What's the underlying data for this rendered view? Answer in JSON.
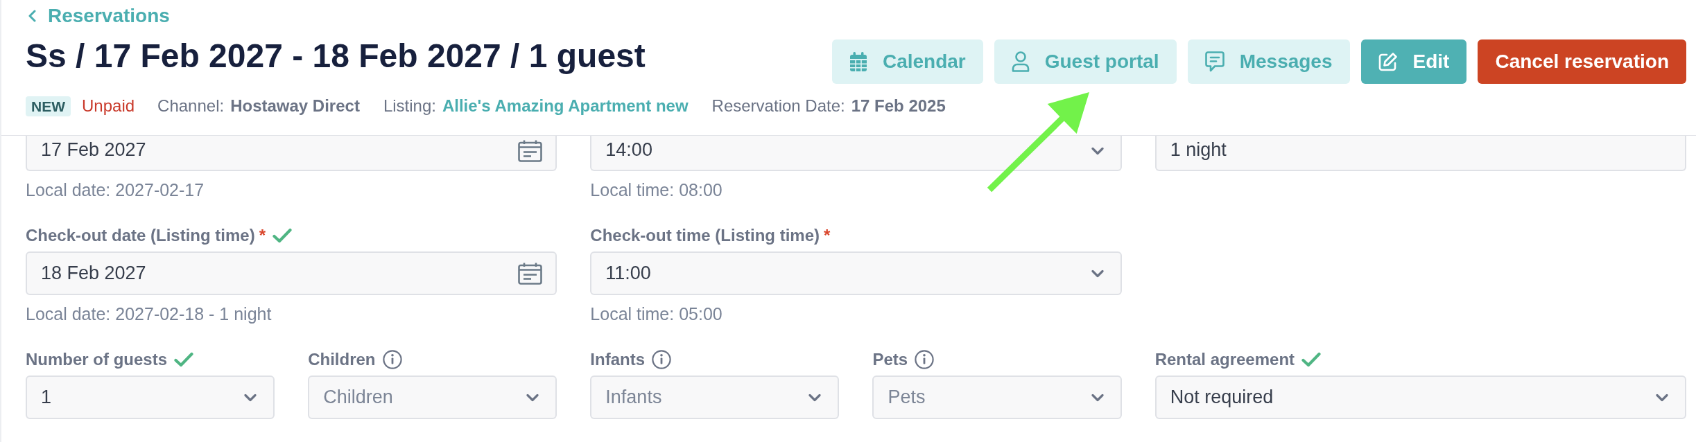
{
  "back_link": {
    "label": "Reservations"
  },
  "title": "Ss / 17 Feb 2027 - 18 Feb 2027 / 1 guest",
  "status": {
    "badge": "NEW",
    "payment": "Unpaid"
  },
  "details": [
    {
      "label": "Channel:",
      "value": "Hostaway Direct",
      "kind": "text"
    },
    {
      "label": "Listing:",
      "value": "Allie's Amazing Apartment new",
      "kind": "link"
    },
    {
      "label": "Reservation Date:",
      "value": "17 Feb 2025",
      "kind": "text"
    }
  ],
  "actions": [
    {
      "label": "Calendar",
      "kind": "soft"
    },
    {
      "label": "Guest portal",
      "kind": "soft"
    },
    {
      "label": "Messages",
      "kind": "soft"
    },
    {
      "label": "Edit",
      "kind": "primary"
    },
    {
      "label": "Cancel reservation",
      "kind": "danger"
    }
  ],
  "form": {
    "rows": [
      {
        "fields": [
          {
            "kind": "date",
            "value": "17 Feb 2027",
            "helper": "Local date: 2027-02-17"
          },
          {
            "kind": "select",
            "value": "14:00",
            "helper": "Local time: 08:00"
          },
          {
            "kind": "text",
            "value": "1 night"
          }
        ]
      },
      {
        "fields": [
          {
            "kind": "date",
            "label": "Check-out date (Listing time)",
            "required_mark": "*",
            "verified": true,
            "info": false,
            "value": "18 Feb 2027",
            "helper": "Local date: 2027-02-18 - 1 night"
          },
          {
            "kind": "select",
            "label": "Check-out time (Listing time)",
            "required_mark": "*",
            "verified": false,
            "info": false,
            "value": "11:00",
            "helper": "Local time: 05:00"
          }
        ]
      },
      {
        "fields": [
          {
            "kind": "select",
            "label": "Number of guests",
            "verified": true,
            "info": false,
            "value": "1"
          },
          {
            "kind": "select",
            "label": "Children",
            "verified": false,
            "info": true,
            "placeholder": "Children"
          },
          {
            "kind": "select",
            "label": "Infants",
            "verified": false,
            "info": true,
            "placeholder": "Infants"
          },
          {
            "kind": "select",
            "label": "Pets",
            "verified": false,
            "info": true,
            "placeholder": "Pets"
          },
          {
            "kind": "select",
            "label": "Rental agreement",
            "verified": true,
            "info": false,
            "value": "Not required"
          }
        ]
      }
    ]
  }
}
